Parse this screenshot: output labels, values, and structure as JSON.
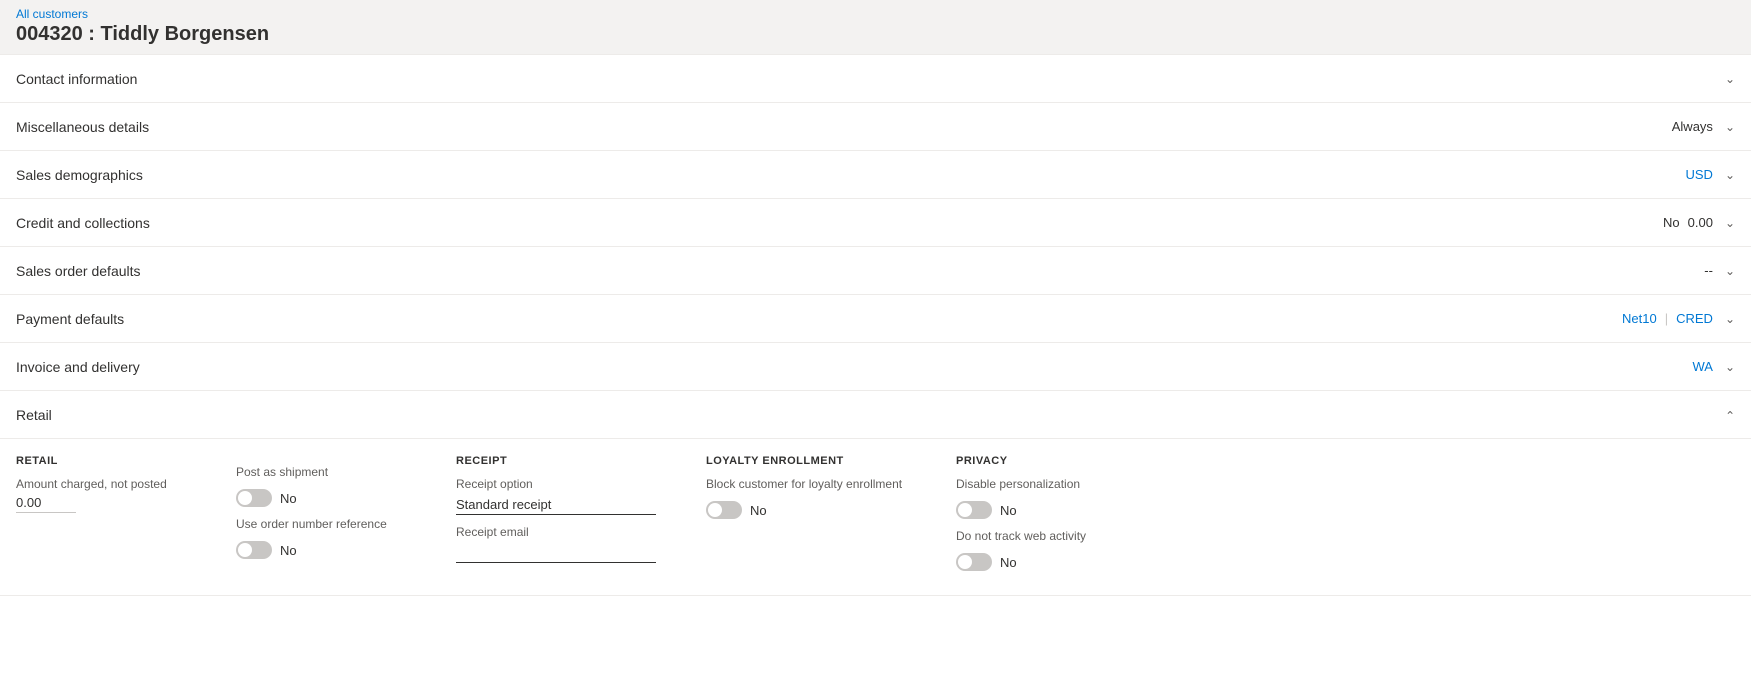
{
  "breadcrumb": {
    "link_label": "All customers"
  },
  "page_title": "004320 : Tiddly Borgensen",
  "sections": [
    {
      "id": "contact-information",
      "title": "Contact information",
      "meta": [],
      "expanded": false,
      "chevron": "down"
    },
    {
      "id": "miscellaneous-details",
      "title": "Miscellaneous details",
      "meta": [
        {
          "label": "Always",
          "blue": false
        }
      ],
      "expanded": false,
      "chevron": "down"
    },
    {
      "id": "sales-demographics",
      "title": "Sales demographics",
      "meta": [
        {
          "label": "USD",
          "blue": true
        }
      ],
      "expanded": false,
      "chevron": "down"
    },
    {
      "id": "credit-and-collections",
      "title": "Credit and collections",
      "meta": [
        {
          "label": "No",
          "blue": false
        },
        {
          "label": "0.00",
          "blue": false
        }
      ],
      "expanded": false,
      "chevron": "down"
    },
    {
      "id": "sales-order-defaults",
      "title": "Sales order defaults",
      "meta": [
        {
          "label": "--",
          "blue": false
        }
      ],
      "expanded": false,
      "chevron": "down"
    },
    {
      "id": "payment-defaults",
      "title": "Payment defaults",
      "meta": [
        {
          "label": "Net10",
          "blue": true
        },
        {
          "label": "CRED",
          "blue": true
        }
      ],
      "expanded": false,
      "chevron": "down"
    },
    {
      "id": "invoice-and-delivery",
      "title": "Invoice and delivery",
      "meta": [
        {
          "label": "WA",
          "blue": true
        }
      ],
      "expanded": false,
      "chevron": "down"
    }
  ],
  "retail_section": {
    "title": "Retail",
    "expanded": true,
    "chevron": "up",
    "retail_col": {
      "label": "RETAIL",
      "amount_label": "Amount charged, not posted",
      "amount_value": "0.00"
    },
    "shipment_col": {
      "post_as_shipment_label": "Post as shipment",
      "post_as_shipment_value": "No",
      "post_as_shipment_toggle": false,
      "use_order_number_label": "Use order number reference",
      "use_order_number_value": "No",
      "use_order_number_toggle": false
    },
    "receipt_col": {
      "label": "RECEIPT",
      "receipt_option_label": "Receipt option",
      "receipt_option_value": "Standard receipt",
      "receipt_email_label": "Receipt email",
      "receipt_email_value": ""
    },
    "loyalty_col": {
      "label": "LOYALTY ENROLLMENT",
      "block_label": "Block customer for loyalty enrollment",
      "block_value": "No",
      "block_toggle": false
    },
    "privacy_col": {
      "label": "PRIVACY",
      "disable_personalization_label": "Disable personalization",
      "disable_personalization_value": "No",
      "disable_personalization_toggle": false,
      "do_not_track_label": "Do not track web activity",
      "do_not_track_value": "No",
      "do_not_track_toggle": false
    }
  }
}
